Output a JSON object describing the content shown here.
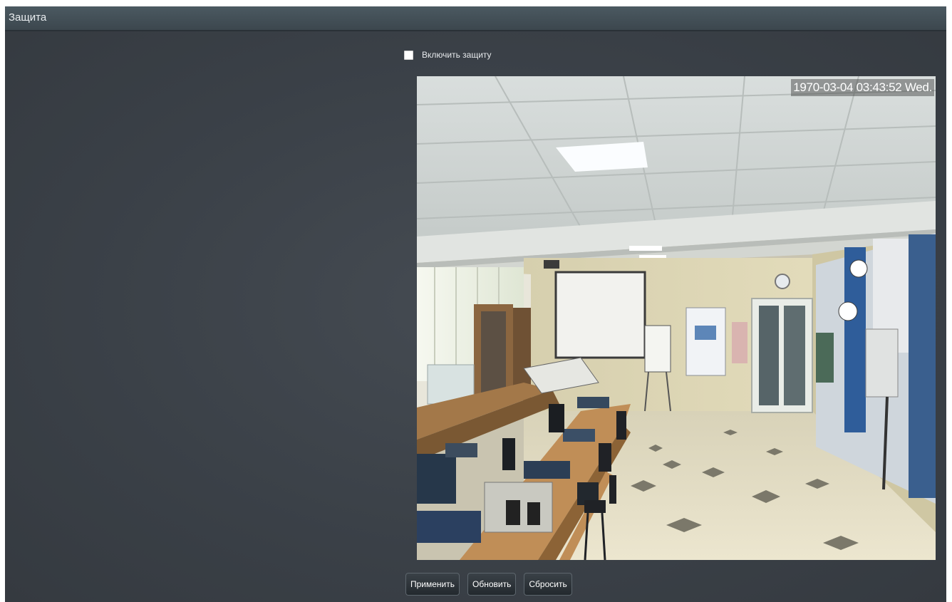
{
  "window": {
    "title": "Защита"
  },
  "protection": {
    "enable_label": "Включить защиту",
    "enabled": false
  },
  "video": {
    "timestamp": "1970-03-04 03:43:52 Wed."
  },
  "buttons": {
    "apply_label": "Применить",
    "refresh_label": "Обновить",
    "reset_label": "Сбросить"
  },
  "colors": {
    "panel_background": "#3d434a",
    "titlebar": "#435058",
    "text": "#e8ecef",
    "button_background": "#2b3137"
  },
  "icons": {
    "checkbox": "checkbox-unchecked-icon"
  }
}
